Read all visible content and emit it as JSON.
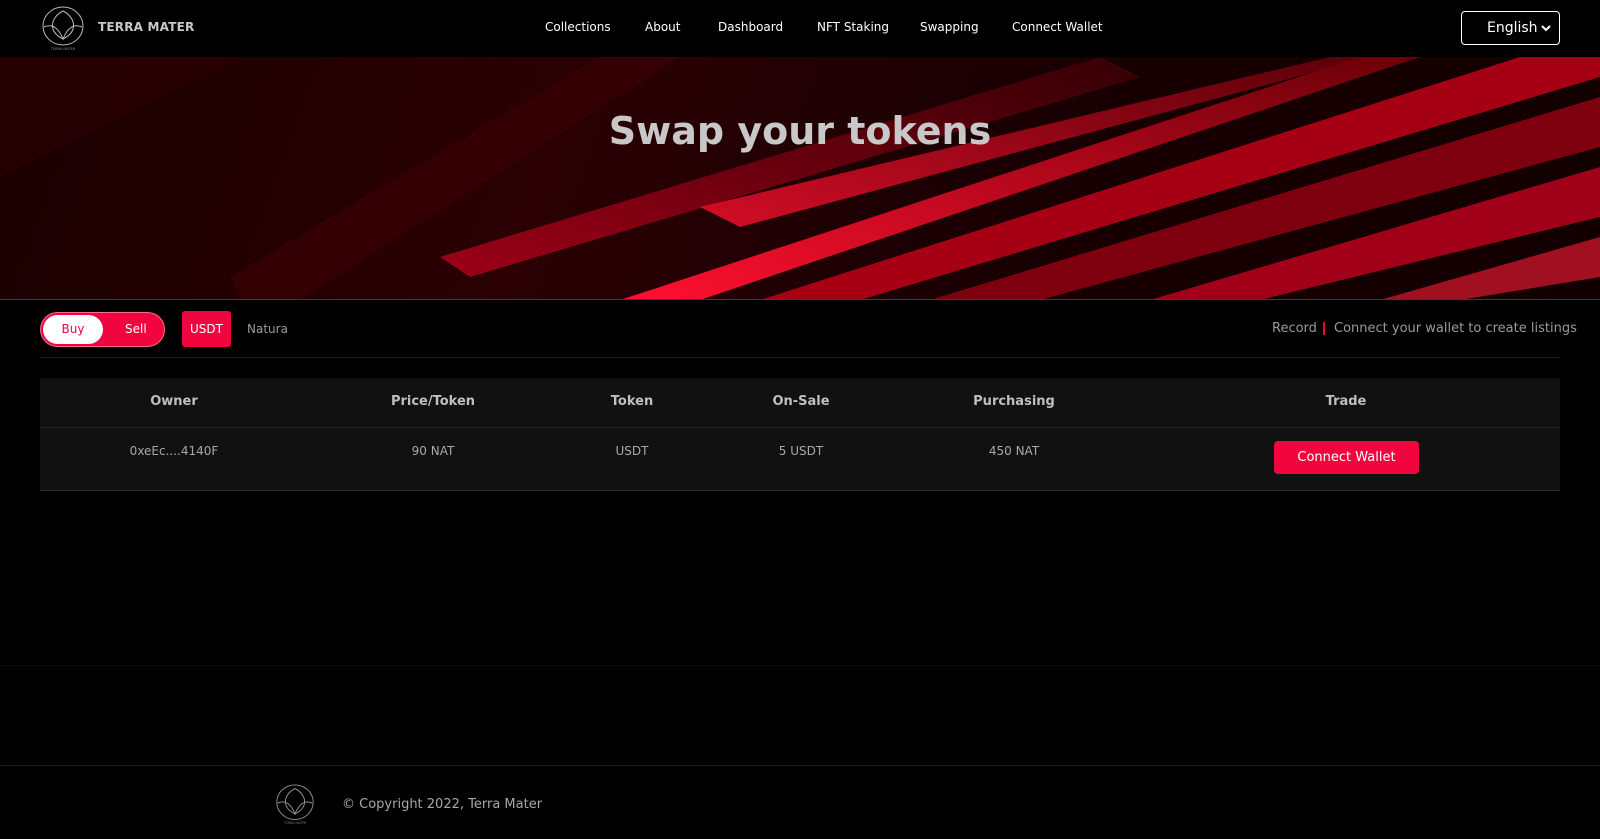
{
  "header": {
    "brand": "TERRA MATER",
    "logo_caption": "TERRA MATER",
    "nav": [
      {
        "label": "Collections"
      },
      {
        "label": "About"
      },
      {
        "label": "Dashboard"
      },
      {
        "label": "NFT Staking"
      },
      {
        "label": "Swapping"
      },
      {
        "label": "Connect Wallet"
      }
    ],
    "language": {
      "selected": "English",
      "icon": "chevron-down-icon"
    }
  },
  "hero": {
    "title": "Swap your tokens"
  },
  "toolbar": {
    "toggle": {
      "buy": "Buy",
      "sell": "Sell",
      "active": "Buy"
    },
    "tabs": [
      {
        "label": "USDT",
        "active": true
      },
      {
        "label": "Natura",
        "active": false
      }
    ],
    "record": "Record",
    "hint": "Connect your wallet to create listings"
  },
  "table": {
    "headers": [
      "Owner",
      "Price/Token",
      "Token",
      "On-Sale",
      "Purchasing",
      "Trade"
    ],
    "rows": [
      {
        "owner": "0xeEc....4140F",
        "price": "90 NAT",
        "token": "USDT",
        "on_sale": "5 USDT",
        "purchasing": "450 NAT",
        "action": "Connect Wallet"
      }
    ]
  },
  "footer": {
    "copyright": "© Copyright 2022, Terra Mater"
  },
  "colors": {
    "accent": "#f0053f",
    "background": "#000000",
    "table_bg": "#111111"
  }
}
